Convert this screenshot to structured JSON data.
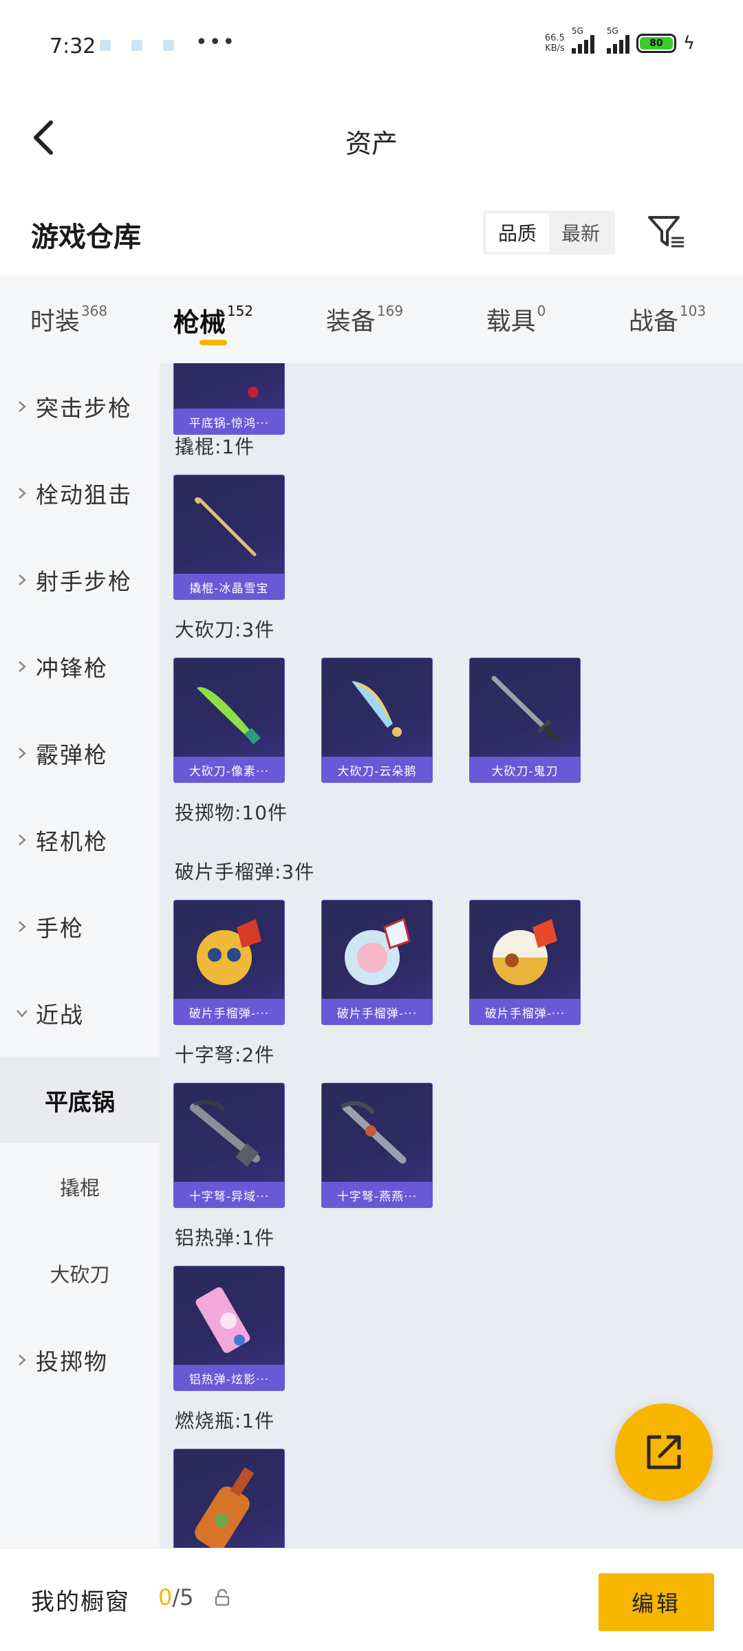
{
  "status_bar": {
    "time": "7:32",
    "more": "•••",
    "net_speed_top": "66.5",
    "net_speed_bottom": "KB/s",
    "network_1": "5G",
    "network_2": "5G",
    "battery": "80"
  },
  "header": {
    "title": "资产"
  },
  "section": {
    "title": "游戏仓库",
    "sort_options": [
      "品质",
      "最新"
    ],
    "active_sort": "最新"
  },
  "tabs": [
    {
      "label": "时装",
      "count": "368"
    },
    {
      "label": "枪械",
      "count": "152",
      "active": true
    },
    {
      "label": "装备",
      "count": "169"
    },
    {
      "label": "载具",
      "count": "0"
    },
    {
      "label": "战备",
      "count": "103"
    }
  ],
  "sidebar": {
    "items": [
      {
        "label": "突击步枪"
      },
      {
        "label": "栓动狙击"
      },
      {
        "label": "射手步枪"
      },
      {
        "label": "冲锋枪"
      },
      {
        "label": "霰弹枪"
      },
      {
        "label": "轻机枪"
      },
      {
        "label": "手枪"
      },
      {
        "label": "近战"
      }
    ],
    "subitems": [
      {
        "label": "平底锅",
        "active": true
      },
      {
        "label": "撬棍"
      },
      {
        "label": "大砍刀"
      }
    ],
    "last_item": {
      "label": "投掷物"
    }
  },
  "content": {
    "partial_card": {
      "label": "平底锅-惊鸿···"
    },
    "groups": [
      {
        "label": "撬棍:1件",
        "items": [
          "撬棍-冰晶雪宝"
        ]
      },
      {
        "label": "大砍刀:3件",
        "items": [
          "大砍刀-像素···",
          "大砍刀-云朵鹅",
          "大砍刀-鬼刀"
        ]
      },
      {
        "label": "投掷物:10件",
        "items": []
      },
      {
        "label": "破片手榴弹:3件",
        "items": [
          "破片手榴弹-···",
          "破片手榴弹-···",
          "破片手榴弹-···"
        ]
      },
      {
        "label": "十字弩:2件",
        "items": [
          "十字弩-异域···",
          "十字弩-燕燕···"
        ]
      },
      {
        "label": "铝热弹:1件",
        "items": [
          "铝热弹-炫影···"
        ]
      },
      {
        "label": "燃烧瓶:1件",
        "items": []
      }
    ]
  },
  "bottom_bar": {
    "label": "我的橱窗",
    "count_current": "0",
    "count_total": "/5",
    "edit_label": "编辑"
  },
  "colors": {
    "accent": "#f7b500",
    "card_label": "#6a58d6",
    "card_bg": "#2d2a62"
  }
}
